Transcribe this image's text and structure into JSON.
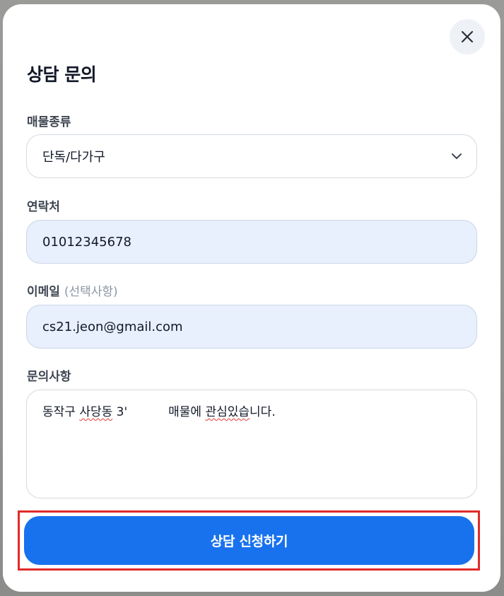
{
  "modal": {
    "title": "상담 문의",
    "close_icon": "close-icon"
  },
  "property_type": {
    "label": "매물종류",
    "value": "단독/다가구",
    "icon": "chevron-down-icon"
  },
  "contact": {
    "label": "연락처",
    "value": "01012345678"
  },
  "email": {
    "label": "이메일",
    "optional_note": "(선택사항)",
    "value": "cs21.jeon@gmail.com"
  },
  "inquiry": {
    "label": "문의사항",
    "text_part1": "동작구 ",
    "text_misspelled1": "사당동",
    "text_part2": " 3'",
    "text_part3": "매물에 ",
    "text_misspelled2": "관심있습",
    "text_part4": "니다."
  },
  "submit": {
    "label": "상담 신청하기"
  },
  "colors": {
    "accent": "#1872ee",
    "highlight_outline": "#e12a2a",
    "filled_field_bg": "#e8effd"
  }
}
